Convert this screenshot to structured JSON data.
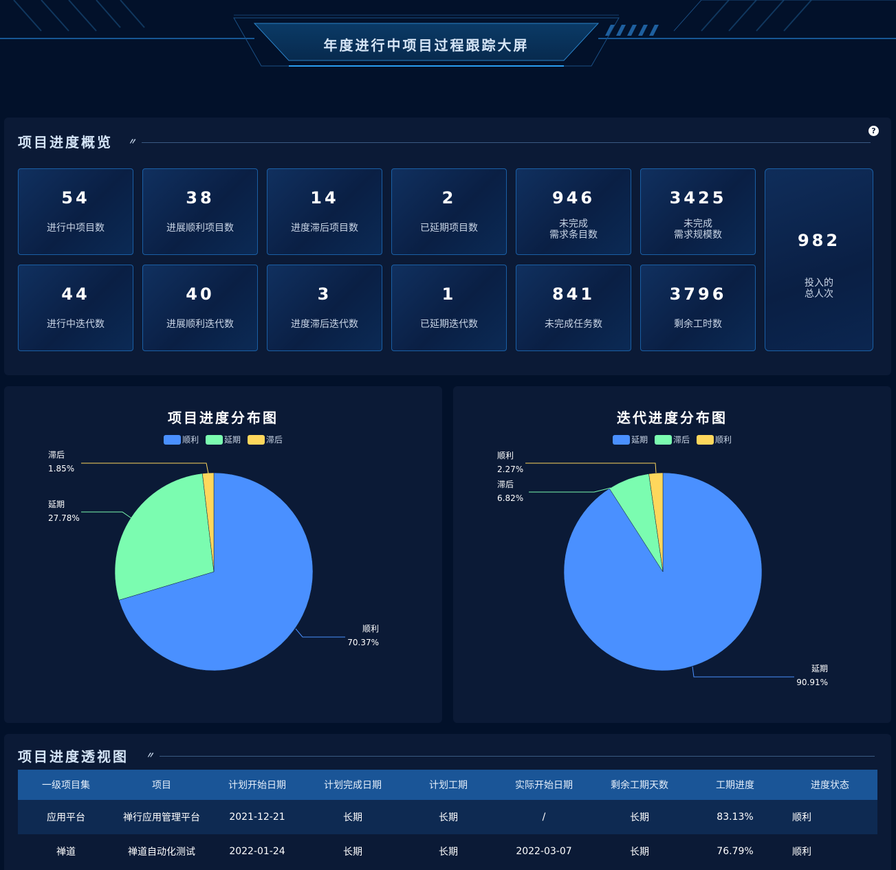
{
  "header": {
    "title": "年度进行中项目过程跟踪大屏"
  },
  "overview": {
    "title": "项目进度概览",
    "stats_row1": [
      {
        "value": "54",
        "label": "进行中项目数"
      },
      {
        "value": "38",
        "label": "进展顺利项目数"
      },
      {
        "value": "14",
        "label": "进度滞后项目数"
      },
      {
        "value": "2",
        "label": "已延期项目数"
      },
      {
        "value": "946",
        "label": "未完成\n需求条目数"
      },
      {
        "value": "3425",
        "label": "未完成\n需求规模数"
      }
    ],
    "stats_row2": [
      {
        "value": "44",
        "label": "进行中迭代数"
      },
      {
        "value": "40",
        "label": "进展顺利迭代数"
      },
      {
        "value": "3",
        "label": "进度滞后迭代数"
      },
      {
        "value": "1",
        "label": "已延期迭代数"
      },
      {
        "value": "841",
        "label": "未完成任务数"
      },
      {
        "value": "3796",
        "label": "剩余工时数"
      }
    ],
    "big_stat": {
      "value": "982",
      "label": "投入的\n总人次"
    }
  },
  "chart_data": [
    {
      "type": "pie",
      "title": "项目进度分布图",
      "legend": [
        "顺利",
        "延期",
        "滞后"
      ],
      "slices": [
        {
          "name": "顺利",
          "value": 70.37,
          "label": "70.37%",
          "color": "#4a90ff"
        },
        {
          "name": "延期",
          "value": 27.78,
          "label": "27.78%",
          "color": "#7bfcb0"
        },
        {
          "name": "滞后",
          "value": 1.85,
          "label": "1.85%",
          "color": "#ffd75c"
        }
      ]
    },
    {
      "type": "pie",
      "title": "迭代进度分布图",
      "legend": [
        "延期",
        "滞后",
        "顺利"
      ],
      "slices": [
        {
          "name": "延期",
          "value": 90.91,
          "label": "90.91%",
          "color": "#4a90ff"
        },
        {
          "name": "滞后",
          "value": 6.82,
          "label": "6.82%",
          "color": "#7bfcb0"
        },
        {
          "name": "顺利",
          "value": 2.27,
          "label": "2.27%",
          "color": "#ffd75c"
        }
      ]
    }
  ],
  "table": {
    "title": "项目进度透视图",
    "columns": [
      "一级项目集",
      "项目",
      "计划开始日期",
      "计划完成日期",
      "计划工期",
      "实际开始日期",
      "剩余工期天数",
      "工期进度",
      "进度状态"
    ],
    "rows": [
      [
        "应用平台",
        "禅行应用管理平台",
        "2021-12-21",
        "长期",
        "长期",
        "/",
        "长期",
        "83.13%",
        "顺利"
      ],
      [
        "禅道",
        "禅道自动化测试",
        "2022-01-24",
        "长期",
        "长期",
        "2022-03-07",
        "长期",
        "76.79%",
        "顺利"
      ]
    ]
  }
}
